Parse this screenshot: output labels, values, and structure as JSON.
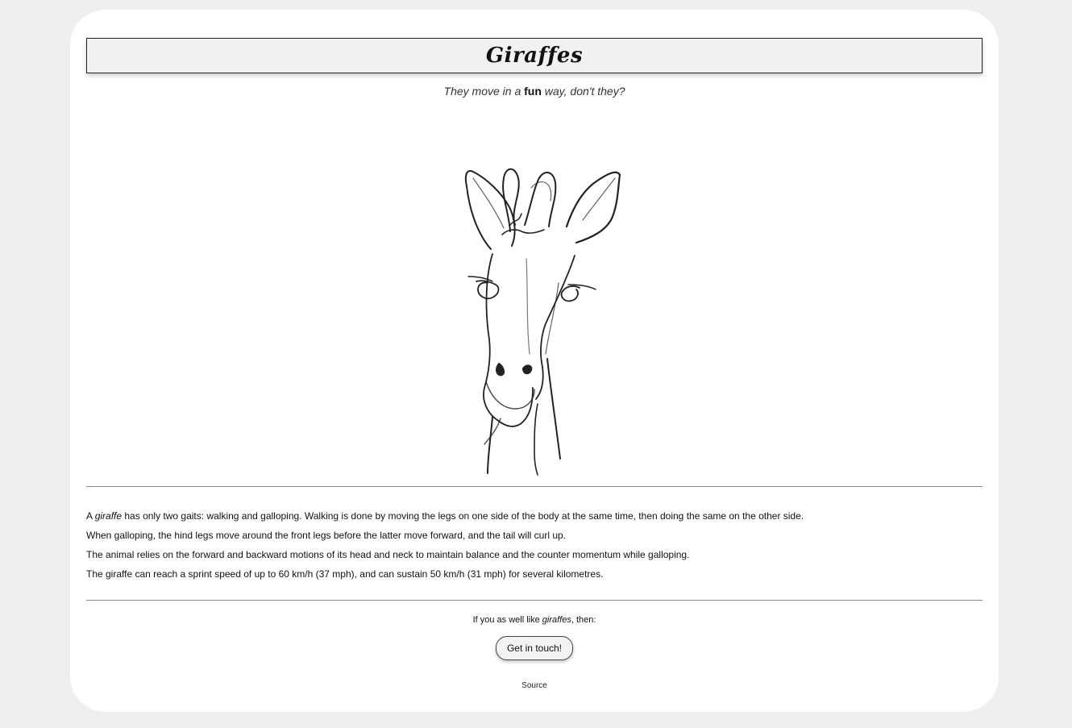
{
  "header": {
    "title": "Giraffes"
  },
  "subtitle": {
    "before": "They move in a ",
    "bold": "fun",
    "after": " way, don't they?"
  },
  "facts": {
    "p1_before": "A ",
    "p1_em": "giraffe",
    "p1_after": " has only two gaits: walking and galloping. Walking is done by moving the legs on one side of the body at the same time, then doing the same on the other side.",
    "p2": "When galloping, the hind legs move around the front legs before the latter move forward, and the tail will curl up.",
    "p3": "The animal relies on the forward and backward motions of its head and neck to maintain balance and the counter momentum while galloping.",
    "p4": "The giraffe can reach a sprint speed of up to 60 km/h (37 mph), and can sustain 50 km/h (31 mph) for several kilometres."
  },
  "cta": {
    "before": "If you as well like ",
    "em": "giraffes",
    "after": ", then:"
  },
  "button": {
    "label": "Get in touch!"
  },
  "footer": {
    "source": "Source"
  },
  "colors": {
    "page_bg": "#efefef",
    "card_bg": "#ffffff",
    "title_bg": "#f1f1f1",
    "line_drawing": "#222222"
  },
  "illustration": {
    "icon": "giraffe-head-line-drawing-icon"
  }
}
